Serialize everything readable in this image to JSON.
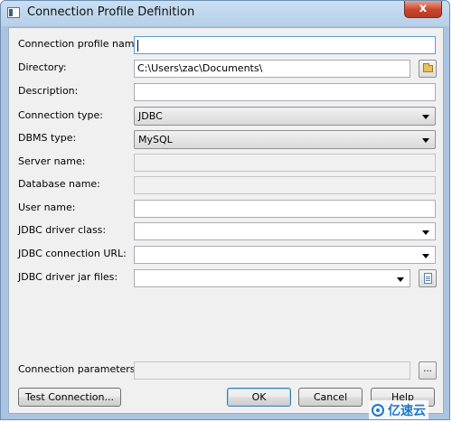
{
  "window": {
    "title": "Connection Profile Definition",
    "close_label": "x"
  },
  "form": {
    "connection_profile_name": {
      "label": "Connection profile name:",
      "value": ""
    },
    "directory": {
      "label": "Directory:",
      "value": "C:\\Users\\zac\\Documents\\"
    },
    "description": {
      "label": "Description:",
      "value": ""
    },
    "connection_type": {
      "label": "Connection type:",
      "value": "JDBC"
    },
    "dbms_type": {
      "label": "DBMS type:",
      "value": "MySQL"
    },
    "server_name": {
      "label": "Server name:",
      "value": ""
    },
    "database_name": {
      "label": "Database name:",
      "value": ""
    },
    "user_name": {
      "label": "User name:",
      "value": ""
    },
    "jdbc_driver_class": {
      "label": "JDBC driver class:",
      "value": ""
    },
    "jdbc_connection_url": {
      "label": "JDBC connection URL:",
      "value": ""
    },
    "jdbc_driver_jar_files": {
      "label": "JDBC driver jar files:",
      "value": ""
    },
    "connection_parameters": {
      "label": "Connection parameters:",
      "value": "",
      "button_label": "..."
    }
  },
  "buttons": {
    "test_connection": "Test Connection...",
    "ok": "OK",
    "cancel": "Cancel",
    "help": "Help"
  },
  "watermark": {
    "text": "亿速云"
  },
  "icons": {
    "title": "window-icon",
    "directory": "folder-icon",
    "jar_files": "document-icon",
    "close": "close-icon"
  }
}
